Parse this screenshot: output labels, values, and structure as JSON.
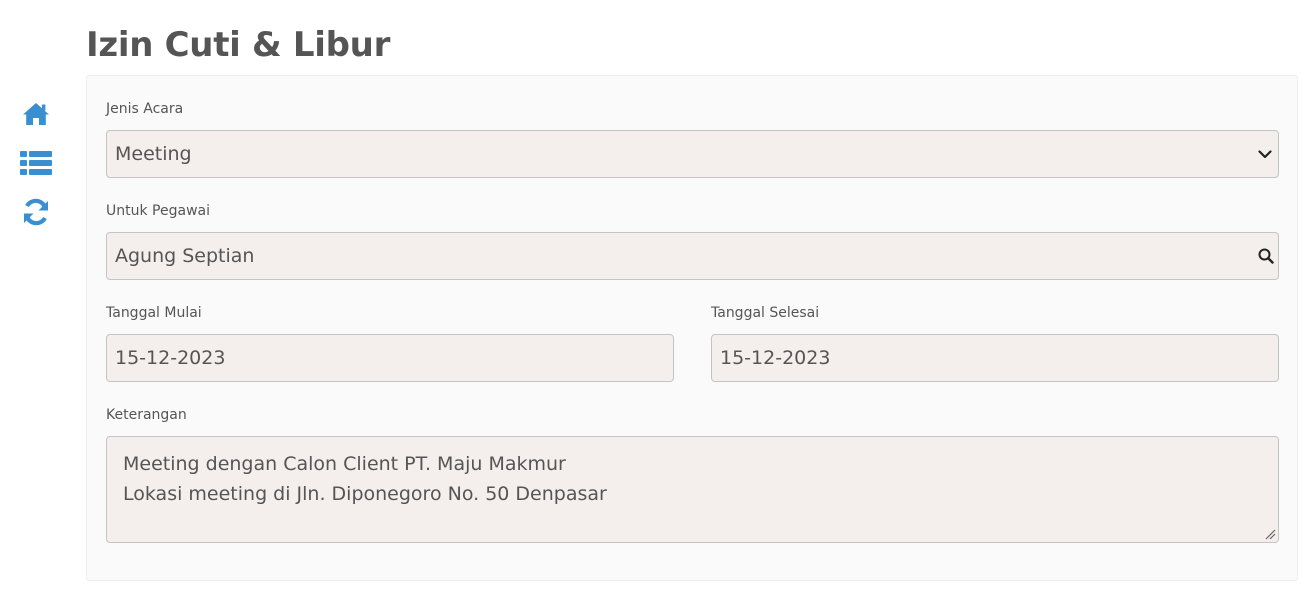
{
  "page": {
    "title": "Izin Cuti & Libur"
  },
  "sidebar": {
    "items": [
      {
        "icon": "home-icon",
        "color": "#3a8fd0"
      },
      {
        "icon": "list-icon",
        "color": "#3a8fd0"
      },
      {
        "icon": "refresh-icon",
        "color": "#3a8fd0"
      }
    ]
  },
  "form": {
    "jenis_acara": {
      "label": "Jenis Acara",
      "value": "Meeting"
    },
    "untuk_pegawai": {
      "label": "Untuk Pegawai",
      "value": "Agung Septian"
    },
    "tanggal_mulai": {
      "label": "Tanggal Mulai",
      "value": "15-12-2023"
    },
    "tanggal_selesai": {
      "label": "Tanggal Selesai",
      "value": "15-12-2023"
    },
    "keterangan": {
      "label": "Keterangan",
      "lines": [
        "Meeting dengan Calon Client PT. Maju Makmur",
        "Lokasi meeting di Jln. Diponegoro No. 50 Denpasar"
      ]
    }
  },
  "colors": {
    "accent": "#3a8fd0",
    "field_bg": "#f4efec",
    "field_border": "#c4c4c4",
    "text": "#555555"
  }
}
